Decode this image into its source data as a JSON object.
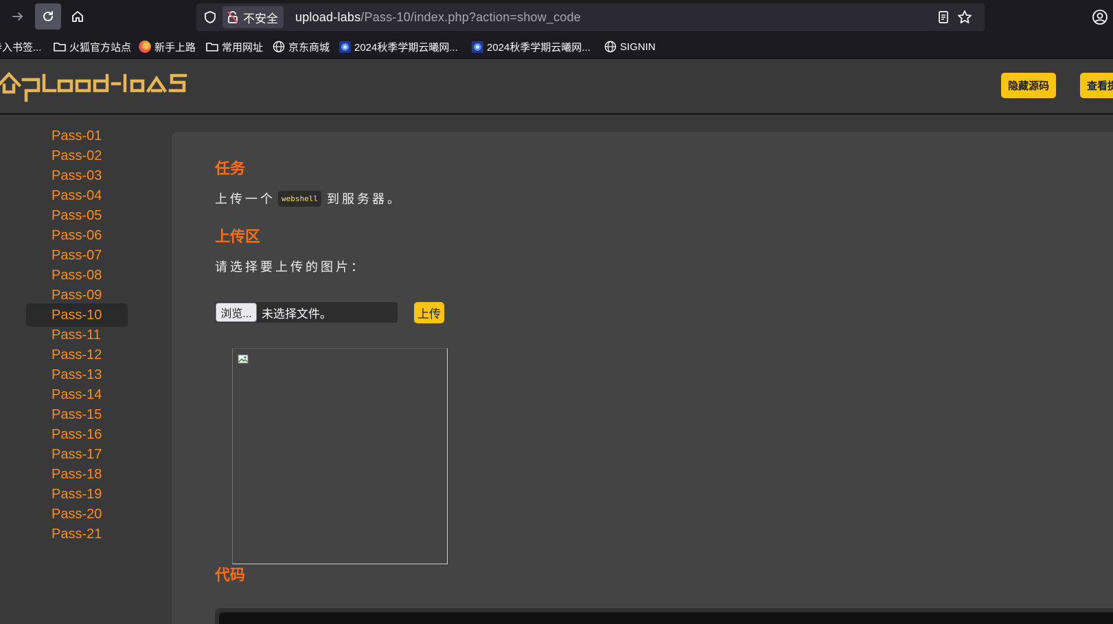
{
  "browser": {
    "url_security_label": "不安全",
    "url_host": "upload-labs",
    "url_path": "/Pass-10/index.php?action=show_code"
  },
  "bookmarks": [
    {
      "label": "导入书签...",
      "icon": "import-icon"
    },
    {
      "label": "火狐官方站点",
      "icon": "folder-icon"
    },
    {
      "label": "新手上路",
      "icon": "firefox-icon"
    },
    {
      "label": "常用网址",
      "icon": "folder-icon"
    },
    {
      "label": "京东商城",
      "icon": "globe-icon"
    },
    {
      "label": "2024秋季学期云曦网...",
      "icon": "site-favicon"
    },
    {
      "label": "2024秋季学期云曦网...",
      "icon": "site-favicon"
    },
    {
      "label": "SIGNIN",
      "icon": "globe-icon"
    }
  ],
  "header": {
    "logo_text": "UpLoad-labs",
    "hide_source_label": "隐藏源码",
    "view_label": "查看提示",
    "accent_color": "#f9c412"
  },
  "sidebar": {
    "active": "Pass-10",
    "items": [
      "Pass-01",
      "Pass-02",
      "Pass-03",
      "Pass-04",
      "Pass-05",
      "Pass-06",
      "Pass-07",
      "Pass-08",
      "Pass-09",
      "Pass-10",
      "Pass-11",
      "Pass-12",
      "Pass-13",
      "Pass-14",
      "Pass-15",
      "Pass-16",
      "Pass-17",
      "Pass-18",
      "Pass-19",
      "Pass-20",
      "Pass-21"
    ]
  },
  "main": {
    "task_heading": "任务",
    "task_text_before": "上传一个",
    "task_code": "webshell",
    "task_text_after": "到服务器。",
    "upload_heading": "上传区",
    "upload_prompt": "请选择要上传的图片：",
    "browse_label": "浏览...",
    "file_status": "未选择文件。",
    "upload_button": "上传",
    "code_heading": "代码",
    "heading_color": "#ff6c17",
    "link_color": "#ff8c1a"
  }
}
